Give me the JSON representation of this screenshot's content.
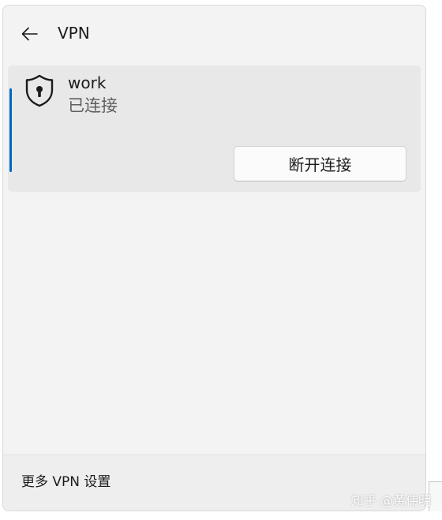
{
  "header": {
    "title": "VPN"
  },
  "connection": {
    "name": "work",
    "status": "已连接",
    "disconnect_label": "断开连接",
    "accent_color": "#0067c0"
  },
  "footer": {
    "settings_link": "更多 VPN 设置"
  },
  "watermark": {
    "text": "知乎 @黄伟明"
  },
  "icons": {
    "back": "back-arrow-icon",
    "connection": "shield-lock-icon"
  }
}
